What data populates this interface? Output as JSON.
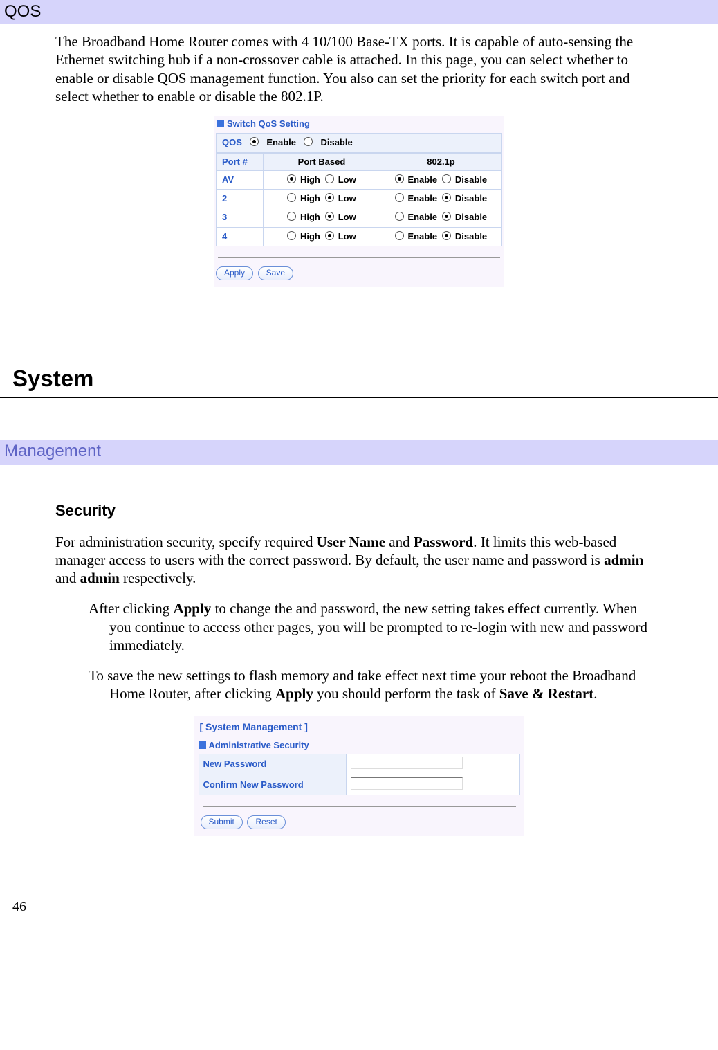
{
  "qos": {
    "heading": "QOS",
    "intro": "The Broadband Home Router comes with 4 10/100 Base-TX ports. It is capable of auto-sensing the   Ethernet switching hub if a non-crossover cable is attached. In this page, you can select whether to enable or disable QOS management function. You also can set the priority for each switch port and select whether to enable or disable the 802.1P.",
    "panel": {
      "title": "Switch QoS Setting",
      "qos_label": "QOS",
      "enable": "Enable",
      "disable": "Disable",
      "headers": {
        "port": "Port #",
        "pb": "Port Based",
        "dot1p": "802.1p"
      },
      "high": "High",
      "low": "Low",
      "rows": [
        {
          "port": "AV",
          "pb_selected": "high",
          "dot1p_selected": "enable"
        },
        {
          "port": "2",
          "pb_selected": "low",
          "dot1p_selected": "disable"
        },
        {
          "port": "3",
          "pb_selected": "low",
          "dot1p_selected": "disable"
        },
        {
          "port": "4",
          "pb_selected": "low",
          "dot1p_selected": "disable"
        }
      ],
      "apply": "Apply",
      "save": "Save"
    }
  },
  "system": {
    "heading": "System",
    "management_heading": "Management",
    "security": {
      "title": "Security",
      "p1_a": "For administration security, specify required ",
      "username_b": "User Name",
      "p1_b": " and ",
      "password_b": "Password",
      "p1_c": ". It limits this web-based manager access to users with the correct password. By default, the user name and password is ",
      "admin1_b": "admin",
      "p1_d": " and ",
      "admin2_b": "admin",
      "p1_e": " respectively.",
      "n1_a": "After clicking ",
      "n1_apply": "Apply",
      "n1_b": " to change the and password, the new setting takes effect currently. When you continue to access other pages, you will be prompted to re-login with new and password immediately.",
      "n2_a": "To save the new settings to flash memory and take effect next time your reboot the Broadband Home Router, after clicking ",
      "n2_apply": "Apply",
      "n2_b": " you should perform the task of ",
      "n2_save": "Save & Restart",
      "n2_c": "."
    },
    "panel": {
      "head": "[ System Management ]",
      "title": "Administrative Security",
      "np": "New Password",
      "cnp": "Confirm New Password",
      "submit": "Submit",
      "reset": "Reset"
    }
  },
  "page": "46"
}
